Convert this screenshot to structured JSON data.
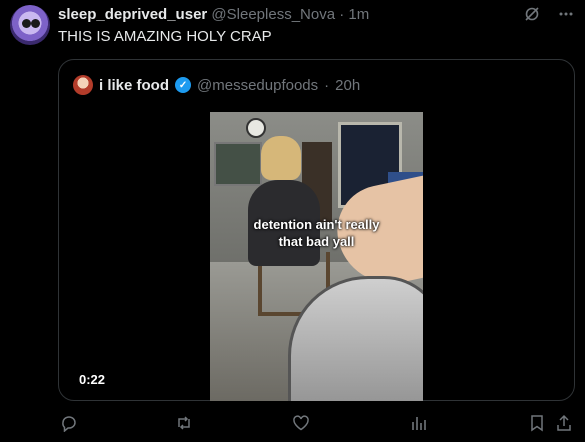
{
  "post": {
    "display_name": "sleep_deprived_user",
    "handle": "@Sleepless_Nova",
    "separator": "·",
    "time": "1m",
    "text": "THIS IS AMAZING HOLY CRAP"
  },
  "quote": {
    "display_name": "i like food",
    "handle": "@messedupfoods",
    "separator": "·",
    "time": "20h",
    "video": {
      "caption_line1": "detention ain't really",
      "caption_line2": "that bad yall",
      "duration": "0:22"
    }
  },
  "icons": {
    "grok": "grok-icon",
    "more": "more-icon",
    "verified": "verified-badge-icon",
    "reply": "reply-icon",
    "repost": "repost-icon",
    "like": "like-icon",
    "views": "views-icon",
    "bookmark": "bookmark-icon",
    "share": "share-icon"
  },
  "colors": {
    "background": "#000000",
    "text": "#e7e9ea",
    "muted": "#71767b",
    "verified": "#1d9bf0",
    "border": "#2f3336"
  }
}
